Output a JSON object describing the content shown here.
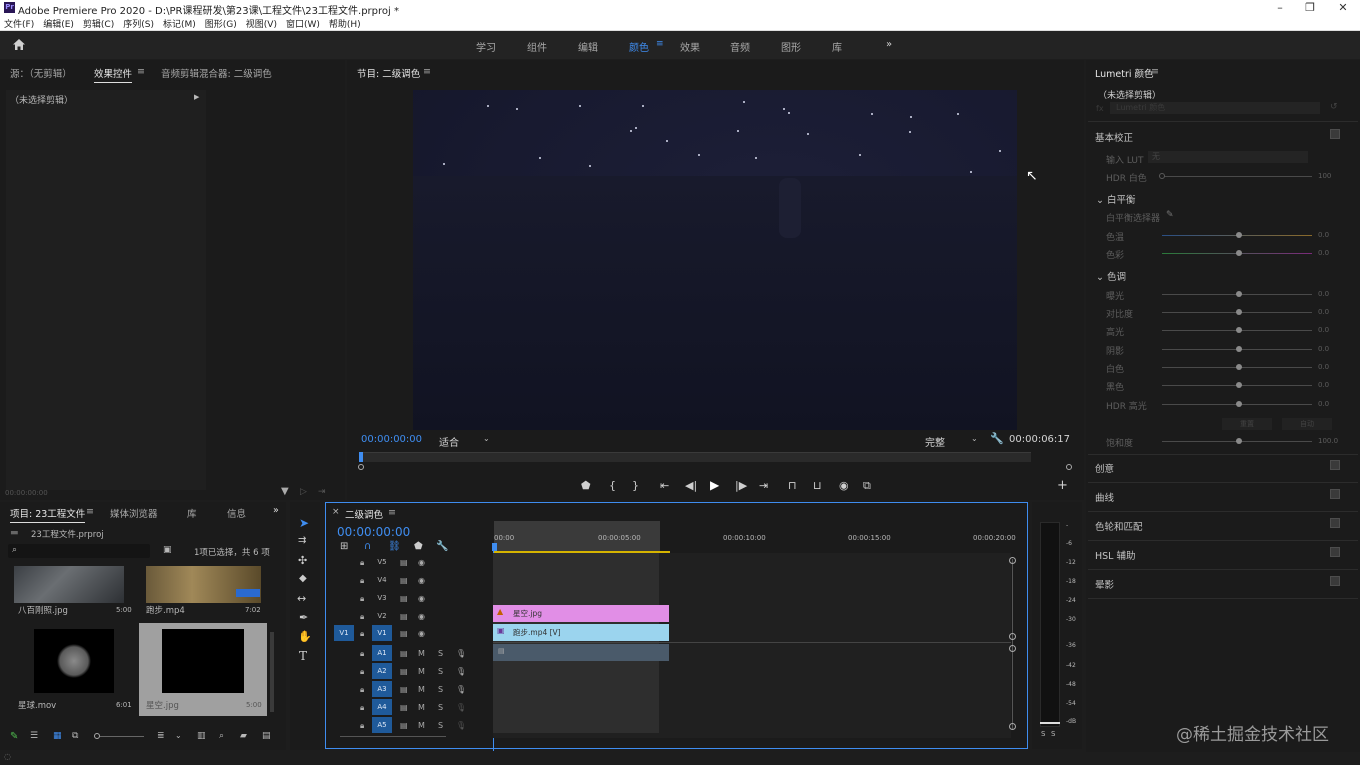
{
  "window": {
    "title": "Adobe Premiere Pro 2020 - D:\\PR课程研发\\第23课\\工程文件\\23工程文件.prproj *",
    "app_icon": "Pr",
    "minimize": "–",
    "restore": "❐",
    "close": "✕"
  },
  "menu": [
    "文件(F)",
    "编辑(E)",
    "剪辑(C)",
    "序列(S)",
    "标记(M)",
    "图形(G)",
    "视图(V)",
    "窗口(W)",
    "帮助(H)"
  ],
  "workspaces": [
    "学习",
    "组件",
    "编辑",
    "颜色",
    "效果",
    "音频",
    "图形",
    "库"
  ],
  "workspace_active": "颜色",
  "workspace_more": "»",
  "source_panel": {
    "tabs": [
      "源：（无剪辑）",
      "效果控件",
      "音频剪辑混合器: 二级调色"
    ],
    "active": "效果控件",
    "no_clip": "（未选择剪辑）",
    "timecode": "00:00:00:00"
  },
  "program": {
    "title": "节目: 二级调色",
    "timecode_in": "00:00:00:00",
    "fit": "适合",
    "quality": "完整",
    "duration": "00:00:06:17"
  },
  "project": {
    "tabs": [
      "项目: 23工程文件",
      "媒体浏览器",
      "库",
      "信息"
    ],
    "file": "23工程文件.prproj",
    "status": "1项已选择，共 6 项",
    "items": [
      {
        "name": "八百刚照.jpg",
        "dur": "5:00"
      },
      {
        "name": "跑步.mp4",
        "dur": "7:02"
      },
      {
        "name": "星球.mov",
        "dur": "6:01"
      },
      {
        "name": "星空.jpg",
        "dur": "5:00"
      }
    ]
  },
  "timeline": {
    "title": "二级调色",
    "timecode": "00:00:00:00",
    "ruler": [
      "00:00",
      "00:00:05:00",
      "00:00:10:00",
      "00:00:15:00",
      "00:00:20:00"
    ],
    "video_tracks": [
      "V5",
      "V4",
      "V3",
      "V2",
      "V1"
    ],
    "audio_tracks": [
      "A1",
      "A2",
      "A3",
      "A4",
      "A5"
    ],
    "clips": [
      {
        "name": "星空.jpg",
        "track": "V2",
        "color": "#e18ee6"
      },
      {
        "name": "跑步.mp4 [V]",
        "track": "V1",
        "color": "#9bd4ee"
      }
    ],
    "src_patch": "V1",
    "levels": [
      "-",
      "-6",
      "-12",
      "-18",
      "-24",
      "-30",
      "-36",
      "-42",
      "-48",
      "-54",
      "-dB"
    ],
    "solo": [
      "S",
      "S"
    ]
  },
  "lumetri": {
    "title": "Lumetri 颜色",
    "no_clip": "（未选择剪辑）",
    "fx_value": "Lumetri 颜色",
    "basic": "基本校正",
    "lut_label": "输入 LUT",
    "lut_value": "无",
    "hdr_white": "HDR 白色",
    "hdr_val": "100",
    "wb": "白平衡",
    "wb_picker": "白平衡选择器",
    "temp": "色温",
    "tint": "色彩",
    "tone": "色调",
    "exposure": "曝光",
    "contrast": "对比度",
    "highlights": "高光",
    "shadows": "阴影",
    "whites": "白色",
    "blacks": "黑色",
    "hdr_spec": "HDR 高光",
    "reset": "重置",
    "auto": "自动",
    "saturation": "饱和度",
    "sat_val": "100.0",
    "zero": "0.0",
    "sections": [
      "创意",
      "曲线",
      "色轮和匹配",
      "HSL 辅助",
      "晕影"
    ]
  },
  "watermark": "@稀土掘金技术社区",
  "colors": {
    "accent": "#3f8df0",
    "pink_clip": "#e18ee6",
    "cyan_clip": "#9bd4ee",
    "playhead": "#3f8df0"
  }
}
